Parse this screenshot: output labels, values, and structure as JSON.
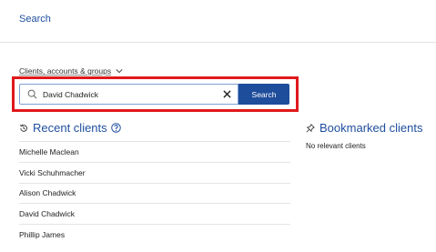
{
  "header": {
    "title": "Search"
  },
  "scope": {
    "selected": "Clients, accounts & groups"
  },
  "search": {
    "value": "David Chadwick",
    "button_label": "Search"
  },
  "recent": {
    "title": "Recent clients",
    "clients": [
      "Michelle Maclean",
      "Vicki Schuhmacher",
      "Alison Chadwick",
      "David Chadwick",
      "Phillip James"
    ]
  },
  "bookmarks": {
    "title": "Bookmarked clients",
    "empty_text": "No relevant clients"
  },
  "colors": {
    "accent": "#1f4fa0",
    "button": "#1e4d9b",
    "highlight": "#e0191b"
  },
  "icons": {
    "search": "magnifier-icon",
    "clear": "close-icon",
    "dropdown": "chevron-down-icon",
    "recent": "history-icon",
    "help": "help-circle-icon",
    "bookmark": "pin-icon"
  }
}
